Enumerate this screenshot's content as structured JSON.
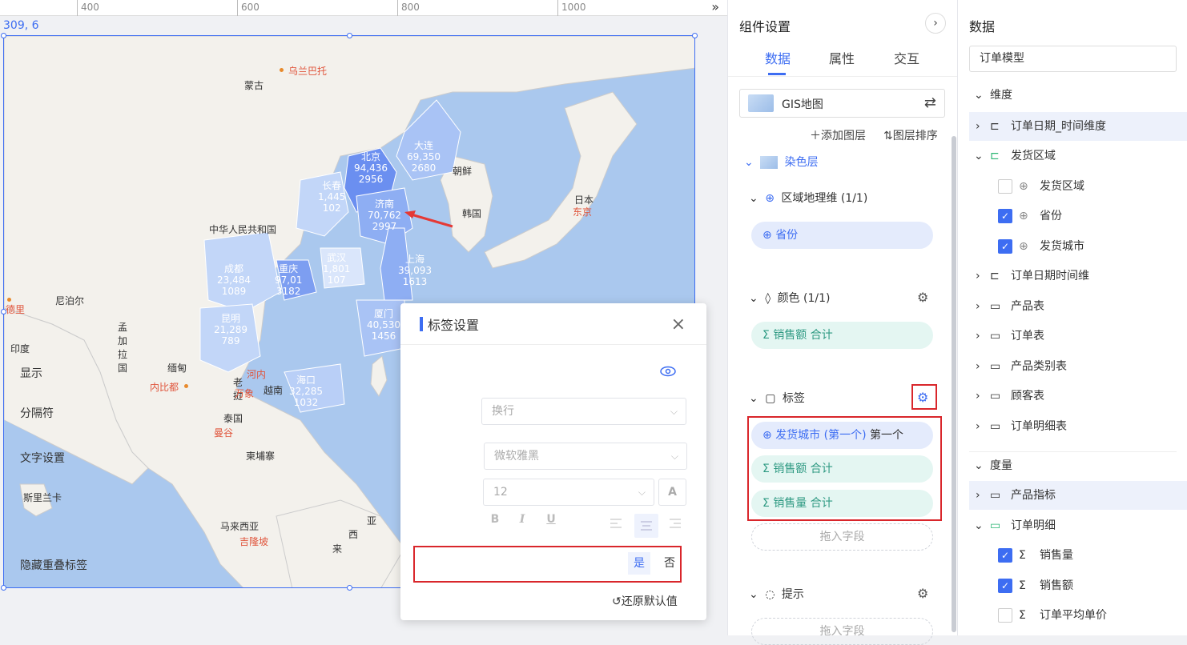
{
  "ruler": {
    "ticks": [
      "400",
      "600",
      "800",
      "1000"
    ],
    "collapse_icon": "double-chevron-right"
  },
  "canvas": {
    "coordinate": "309, 6"
  },
  "map": {
    "countries": {
      "mongolia": "蒙古",
      "china": "中华人民共和国",
      "nepal": "尼泊尔",
      "india": "印度",
      "bangladesh": "孟加拉国",
      "myanmar": "缅甸",
      "laos": "老挝",
      "thailand": "泰国",
      "vietnam": "越南",
      "cambodia": "柬埔寨",
      "sri_lanka": "斯里兰卡",
      "malaysia": "马来西亚",
      "north_korea": "朝鲜",
      "south_korea": "韩国",
      "japan": "日本",
      "xi": "西",
      "ya": "亚",
      "lai": "来"
    },
    "cities": {
      "ulaanbaatar": "乌兰巴托",
      "delhi": "德里",
      "naypyidaw": "内比都",
      "hanoi": "河内",
      "vientiane": "万象",
      "bangkok": "曼谷",
      "kuala_lumpur": "吉隆坡",
      "tokyo": "东京"
    },
    "data_labels": [
      {
        "city": "北京",
        "sales": "94,436",
        "qty": "2956"
      },
      {
        "city": "大连",
        "sales": "69,350",
        "qty": "2680"
      },
      {
        "city": "长春",
        "sales": "1,445",
        "qty": "102"
      },
      {
        "city": "济南",
        "sales": "70,762",
        "qty": "2997"
      },
      {
        "city": "成都",
        "sales": "23,484",
        "qty": "1089"
      },
      {
        "city": "重庆",
        "sales": "97,01",
        "qty": "3182"
      },
      {
        "city": "武汉",
        "sales": "1,801",
        "qty": "107"
      },
      {
        "city": "上海",
        "sales": "39,093",
        "qty": "1613"
      },
      {
        "city": "昆明",
        "sales": "21,289",
        "qty": "789"
      },
      {
        "city": "厦门",
        "sales": "40,530",
        "qty": "1456"
      },
      {
        "city": "海口",
        "sales": "32,285",
        "qty": "1032"
      }
    ]
  },
  "dialog": {
    "title": "标签设置",
    "show_label": "显示",
    "separator_label": "分隔符",
    "separator_value": "换行",
    "text_label": "文字设置",
    "font_value": "微软雅黑",
    "size_value": "12",
    "font_color_icon": "A",
    "bold": "B",
    "italic": "I",
    "underline": "U",
    "hide_overlap_label": "隐藏重叠标签",
    "yes": "是",
    "no": "否",
    "reset": "还原默认值"
  },
  "panel": {
    "title": "组件设置",
    "tabs": [
      "数据",
      "属性",
      "交互"
    ],
    "active_tab": "数据",
    "chart_type": "GIS地图",
    "add_layer": "添加图层",
    "sort_layers": "图层排序",
    "layer_name": "染色层",
    "region_dim": "区域地理维 (1/1)",
    "region_field": "省份",
    "color_section": "颜色 (1/1)",
    "color_field": "销售额",
    "color_field_agg": "合计",
    "label_section": "标签",
    "label_fields": [
      {
        "name": "发货城市 (第一个)",
        "agg": "第一个",
        "kind": "dimension"
      },
      {
        "name": "销售额",
        "agg": "合计",
        "kind": "measure"
      },
      {
        "name": "销售量",
        "agg": "合计",
        "kind": "measure"
      }
    ],
    "drop_hint": "拖入字段",
    "tooltip_section": "提示",
    "drop_hint_2": "拖入字段"
  },
  "data_panel": {
    "title": "数据",
    "model": "订单模型",
    "dimension_group": "维度",
    "dimensions": [
      {
        "label": "订单日期_时间维度"
      },
      {
        "label": "发货区域"
      },
      {
        "label": "发货区域",
        "checked": false
      },
      {
        "label": "省份",
        "checked": true
      },
      {
        "label": "发货城市",
        "checked": true
      },
      {
        "label": "订单日期时间维"
      },
      {
        "label": "产品表"
      },
      {
        "label": "订单表"
      },
      {
        "label": "产品类别表"
      },
      {
        "label": "顾客表"
      },
      {
        "label": "订单明细表"
      }
    ],
    "measure_group": "度量",
    "measures": [
      {
        "label": "产品指标"
      },
      {
        "label": "订单明细"
      },
      {
        "label": "销售量",
        "checked": true
      },
      {
        "label": "销售额",
        "checked": true
      },
      {
        "label": "订单平均单价",
        "checked": false
      }
    ]
  },
  "colors": {
    "accent": "#3d6df2",
    "highlight_red": "#d9262b",
    "sea": "#aac8ee",
    "land": "#f3f1ec"
  }
}
